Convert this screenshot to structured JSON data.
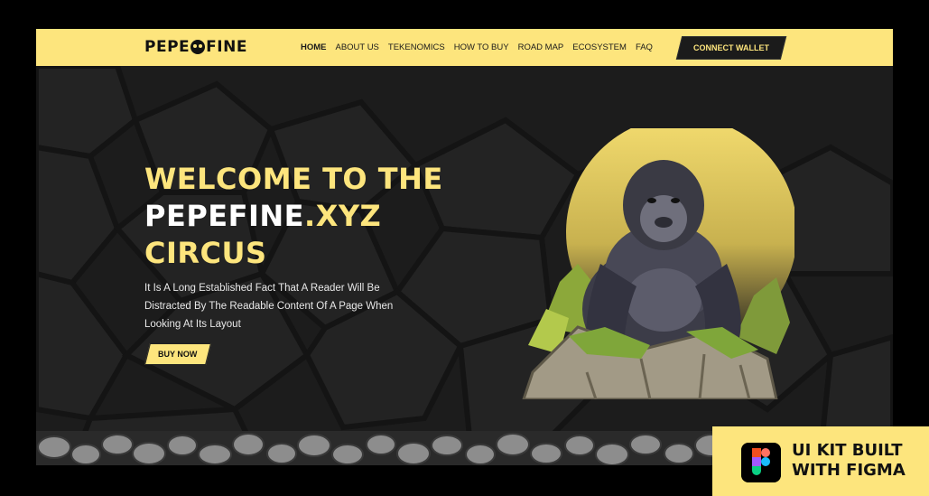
{
  "logo": {
    "left": "PEPE",
    "right": "FINE"
  },
  "nav": {
    "items": [
      "HOME",
      "ABOUT US",
      "TEKENOMICS",
      "HOW TO BUY",
      "ROAD MAP",
      "ECOSYSTEM",
      "FAQ"
    ],
    "active": "HOME"
  },
  "connect_label": "CONNECT WALLET",
  "hero": {
    "line1": "WELCOME TO THE",
    "line2_white": "PEPEFINE",
    "line2_yellow": ".XYZ",
    "line3": "CIRCUS",
    "description": "It Is A Long Established Fact That A Reader Will Be Distracted By The Readable Content Of A Page When Looking At Its Layout",
    "cta": "BUY NOW"
  },
  "badge": {
    "line1": "UI KIT BUILT",
    "line2": "WITH FIGMA"
  },
  "colors": {
    "accent": "#fde57d",
    "dark": "#1d1d1d",
    "background": "#000000"
  },
  "icons": [
    "gorilla-illustration",
    "figma-icon",
    "logo-face-icon"
  ]
}
